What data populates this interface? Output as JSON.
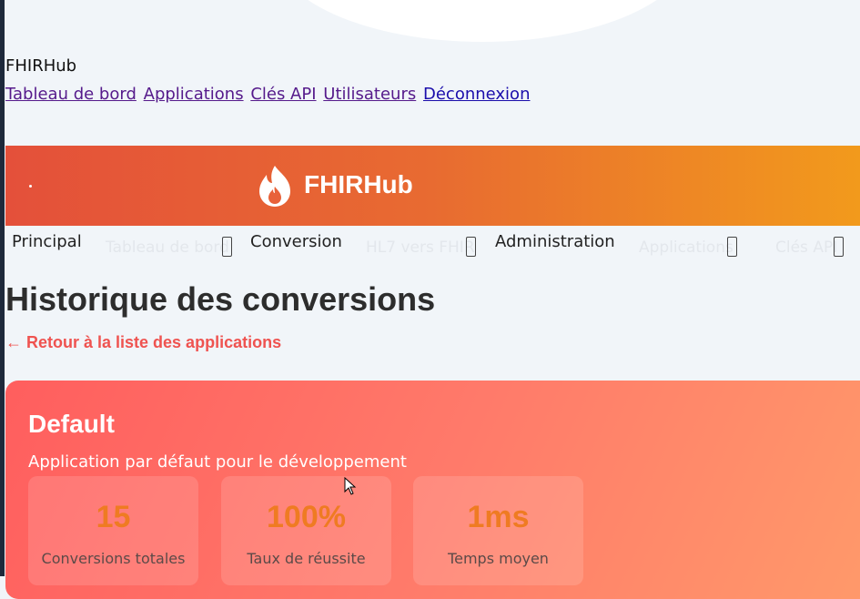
{
  "raw_header": {
    "brand": "FHIRHub",
    "links": [
      {
        "label": "Tableau de bord"
      },
      {
        "label": "Applications"
      },
      {
        "label": "Clés API"
      },
      {
        "label": "Utilisateurs"
      },
      {
        "label": "Déconnexion"
      }
    ]
  },
  "banner": {
    "title": "FHIRHub",
    "logo_icon": "flame-icon",
    "gradient_start": "#e4503a",
    "gradient_end": "#f29a1c"
  },
  "menu": {
    "sections": [
      {
        "label": "Principal",
        "item": "Tableau de bord"
      },
      {
        "label": "Conversion",
        "item": "HL7 vers FHIR"
      },
      {
        "label": "Administration",
        "item": "Applications"
      },
      {
        "label": "",
        "item": "Clés API"
      }
    ]
  },
  "page": {
    "title": "Historique des conversions",
    "back_link": "← Retour à la liste des applications"
  },
  "app_card": {
    "name": "Default",
    "description": "Application par défaut pour le développement",
    "stats": [
      {
        "value": "15",
        "label": "Conversions totales"
      },
      {
        "value": "100%",
        "label": "Taux de réussite"
      },
      {
        "value": "1ms",
        "label": "Temps moyen"
      }
    ],
    "accent_color": "#ef7b22"
  }
}
